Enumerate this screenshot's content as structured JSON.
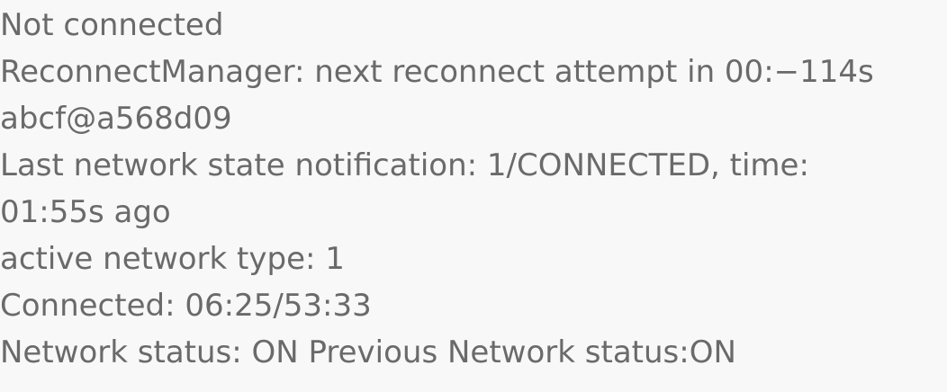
{
  "status_lines": [
    "Not connected",
    "ReconnectManager: next reconnect attempt in 00:−114s",
    "abcf@a568d09",
    "Last network state notification: 1/CONNECTED, time:",
    "01:55s ago",
    "active network type: 1",
    "Connected: 06:25/53:33",
    "Network status: ON Previous Network status:ON"
  ],
  "colors": {
    "background": "#f8f8f8",
    "text": "#6a6a6a"
  }
}
